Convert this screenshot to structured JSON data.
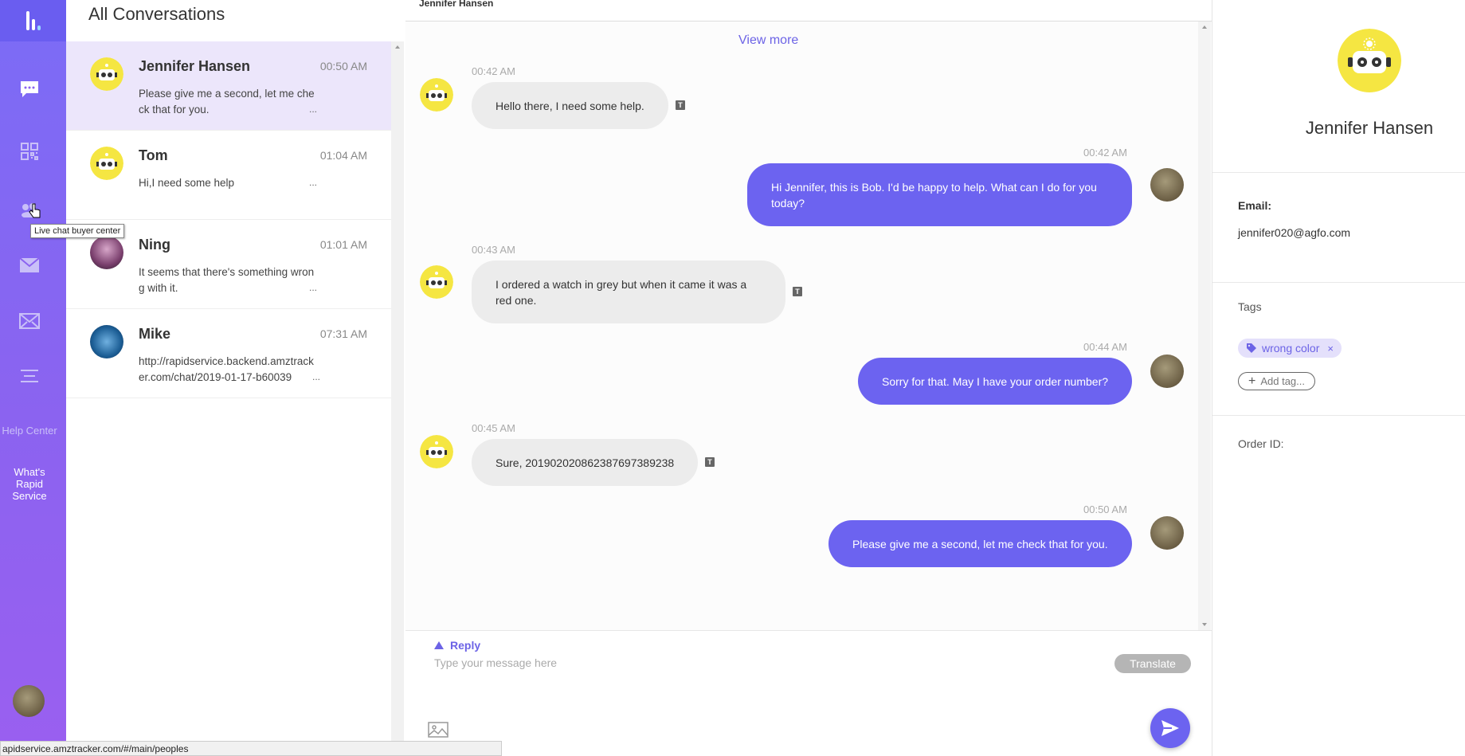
{
  "sidebar": {
    "nav": [
      {
        "icon": "chat-bubble-icon"
      },
      {
        "icon": "qr-code-icon"
      },
      {
        "icon": "users-icon"
      },
      {
        "icon": "mail-icon"
      },
      {
        "icon": "envelope-icon"
      },
      {
        "icon": "menu-lines-icon"
      }
    ],
    "tooltip": "Live chat buyer center",
    "help_center": "Help Center",
    "whats_rapid": "What's Rapid Service"
  },
  "conversations": {
    "title": "All Conversations",
    "items": [
      {
        "name": "Jennifer Hansen",
        "time": "00:50 AM",
        "preview": "Please give me a second, let me check that for you.",
        "dots": "...",
        "active": true
      },
      {
        "name": "Tom",
        "time": "01:04 AM",
        "preview": "Hi,I need some help",
        "dots": "...",
        "active": false
      },
      {
        "name": "Ning",
        "time": "01:01 AM",
        "preview": "It seems that there's something wrong with it.",
        "dots": "...",
        "active": false
      },
      {
        "name": "Mike",
        "time": "07:31 AM",
        "preview": "http://rapidservice.backend.amztracker.com/chat/2019-01-17-b60039",
        "dots": "...",
        "active": false
      }
    ]
  },
  "chat": {
    "header_name": "Jennifer Hansen",
    "view_more": "View more",
    "messages": [
      {
        "dir": "in",
        "time": "00:42 AM",
        "text": "Hello there, I need some help."
      },
      {
        "dir": "out",
        "time": "00:42 AM",
        "text": "Hi Jennifer, this is Bob. I'd be happy to help. What can I do for you today?"
      },
      {
        "dir": "in",
        "time": "00:43 AM",
        "text": "I ordered a watch in grey but when it came it was a red one."
      },
      {
        "dir": "out",
        "time": "00:44 AM",
        "text": "Sorry for that. May I have your order number?"
      },
      {
        "dir": "in",
        "time": "00:45 AM",
        "text": "Sure, 20190202086238769738923​8"
      },
      {
        "dir": "out",
        "time": "00:50 AM",
        "text": "Please give me a second, let me check that for you."
      }
    ],
    "translate_mark": "T"
  },
  "reply": {
    "label": "Reply",
    "placeholder": "Type your message here",
    "translate_label": "Translate"
  },
  "customer": {
    "name": "Jennifer Hansen",
    "email_label": "Email:",
    "email": "jennifer020@agfo.com",
    "tags_label": "Tags",
    "tags": [
      "wrong color"
    ],
    "add_tag_label": "Add tag...",
    "order_id_label": "Order ID:"
  },
  "status_bar": "apidservice.amztracker.com/#/main/peoples",
  "colors": {
    "accent": "#6c63f0",
    "sidebar": "#8b63f0",
    "active_row": "#ece6fb",
    "bot_yellow": "#f5e642"
  }
}
